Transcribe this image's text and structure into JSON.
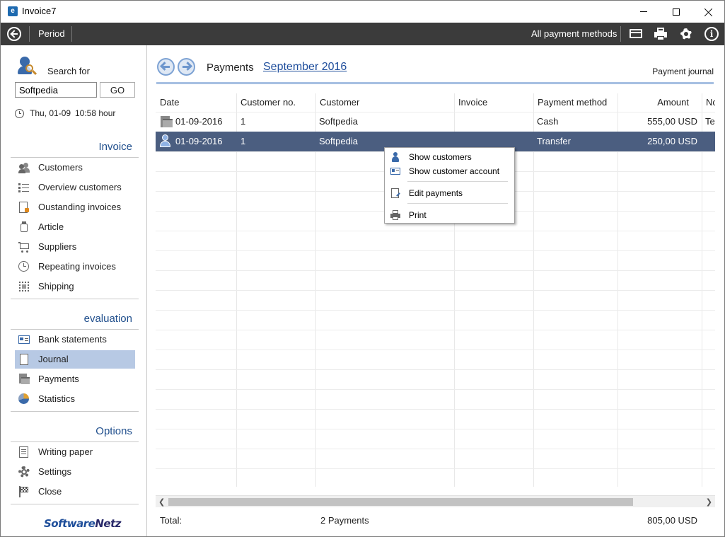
{
  "window": {
    "title": "Invoice7",
    "icon_letter": "e"
  },
  "toolbar": {
    "period_label": "Period",
    "payment_methods_label": "All payment methods"
  },
  "sidebar": {
    "search_label": "Search for",
    "search_value": "Softpedia",
    "go_label": "GO",
    "date": "Thu, 01-09",
    "time": "10:58 hour",
    "sections": [
      {
        "title": "Invoice",
        "items": [
          {
            "label": "Customers",
            "icon": "customers-icon"
          },
          {
            "label": "Overview customers",
            "icon": "list-icon"
          },
          {
            "label": "Oustanding invoices",
            "icon": "outstanding-invoice-icon"
          },
          {
            "label": "Article",
            "icon": "article-icon"
          },
          {
            "label": "Suppliers",
            "icon": "cart-icon"
          },
          {
            "label": "Repeating invoices",
            "icon": "clock-icon"
          },
          {
            "label": "Shipping",
            "icon": "stamp-icon"
          }
        ]
      },
      {
        "title": "evaluation",
        "items": [
          {
            "label": "Bank statements",
            "icon": "bank-statement-icon"
          },
          {
            "label": "Journal",
            "icon": "document-icon",
            "active": true
          },
          {
            "label": "Payments",
            "icon": "payments-icon"
          },
          {
            "label": "Statistics",
            "icon": "pie-chart-icon"
          }
        ]
      },
      {
        "title": "Options",
        "items": [
          {
            "label": "Writing paper",
            "icon": "paper-icon"
          },
          {
            "label": "Settings",
            "icon": "gear-icon"
          },
          {
            "label": "Close",
            "icon": "flag-icon"
          }
        ]
      }
    ],
    "logo": {
      "part1": "Software",
      "part2": "Netz"
    }
  },
  "main": {
    "title": "Payments",
    "period": "September 2016",
    "view_label": "Payment journal",
    "columns": [
      "Date",
      "Customer no.",
      "Customer",
      "Invoice",
      "Payment method",
      "Amount",
      "No"
    ],
    "rows": [
      {
        "icon": "payment-doc-icon",
        "date": "01-09-2016",
        "customer_no": "1",
        "customer": "Softpedia",
        "invoice": "",
        "method": "Cash",
        "amount": "555,00 USD",
        "note": "Te"
      },
      {
        "icon": "customer-icon",
        "date": "01-09-2016",
        "customer_no": "1",
        "customer": "Softpedia",
        "invoice": "",
        "method": "Transfer",
        "amount": "250,00 USD",
        "note": "",
        "selected": true
      }
    ],
    "footer": {
      "total_label": "Total:",
      "count": "2 Payments",
      "amount": "805,00 USD"
    }
  },
  "context_menu": {
    "items": [
      {
        "label": "Show customers",
        "icon": "customer-icon"
      },
      {
        "label": "Show customer account",
        "icon": "account-card-icon"
      },
      {
        "label": "Edit payments",
        "icon": "edit-document-icon"
      },
      {
        "label": "Print",
        "icon": "printer-icon"
      }
    ]
  },
  "colors": {
    "toolbar_bg": "#3b3b3b",
    "accent_blue": "#1f4e8c",
    "selected_row": "#4b5e80",
    "sidebar_active": "#b7c9e4"
  }
}
